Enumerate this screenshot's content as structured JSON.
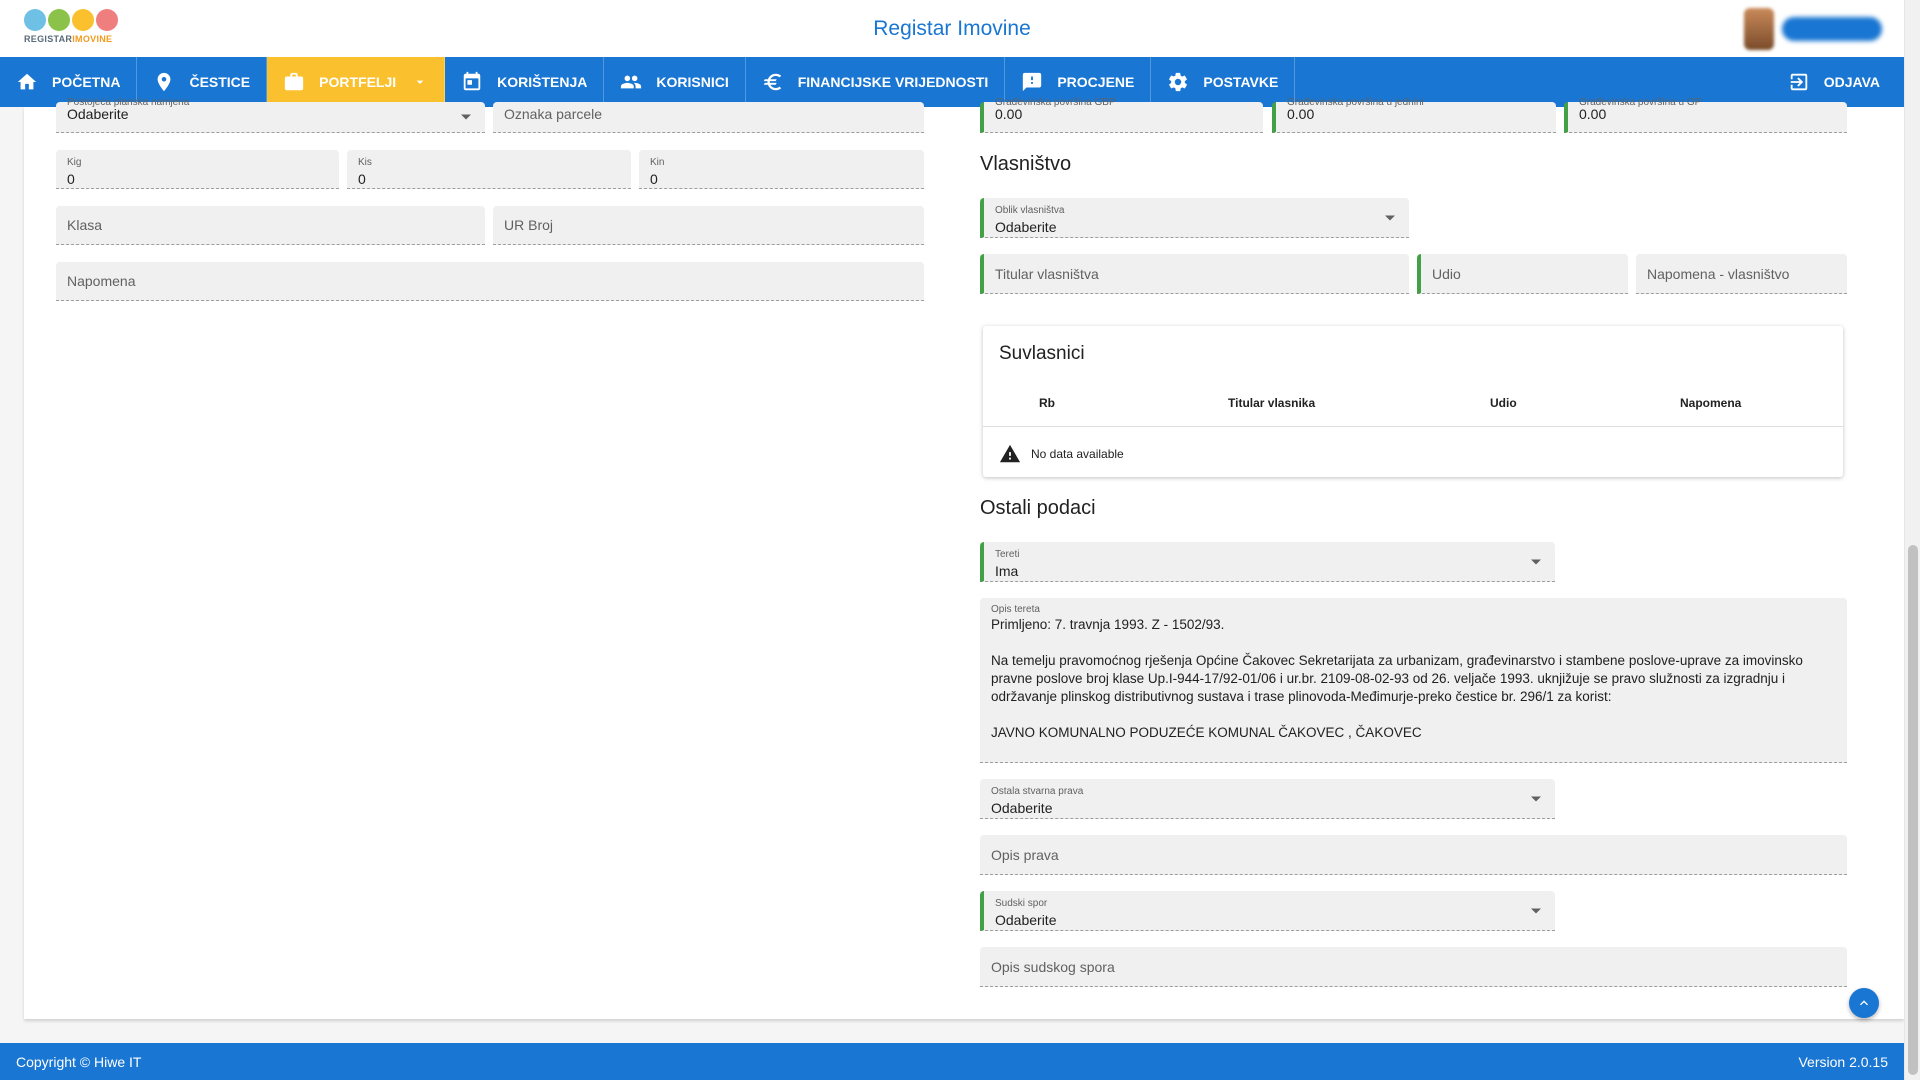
{
  "header": {
    "logo_text_a": "REGISTAR",
    "logo_text_b": "IMOVINE",
    "app_title": "Registar Imovine"
  },
  "nav": {
    "items": [
      {
        "label": "POČETNA",
        "icon": "home-icon"
      },
      {
        "label": "ČESTICE",
        "icon": "map-pin-icon"
      },
      {
        "label": "PORTFELJI",
        "icon": "briefcase-icon"
      },
      {
        "label": "KORIŠTENJA",
        "icon": "calendar-icon"
      },
      {
        "label": "KORISNICI",
        "icon": "people-icon"
      },
      {
        "label": "FINANCIJSKE VRIJEDNOSTI",
        "icon": "euro-icon"
      },
      {
        "label": "PROCJENE",
        "icon": "feedback-icon"
      },
      {
        "label": "POSTAVKE",
        "icon": "gear-icon"
      }
    ],
    "logout_label": "ODJAVA",
    "active_color": "#fbc02d",
    "bar_color": "#1976d2"
  },
  "left": {
    "namjena": {
      "label": "Postojeća planska namjena",
      "value": "Odaberite"
    },
    "oznaka_parcele": {
      "placeholder": "Oznaka parcele"
    },
    "kig": {
      "label": "Kig",
      "value": "0"
    },
    "kis": {
      "label": "Kis",
      "value": "0"
    },
    "kin": {
      "label": "Kin",
      "value": "0"
    },
    "klasa": {
      "placeholder": "Klasa"
    },
    "ur_broj": {
      "placeholder": "UR Broj"
    },
    "napomena": {
      "placeholder": "Napomena"
    }
  },
  "right": {
    "povrsine": [
      {
        "label": "Građevinska površina GBP",
        "value": "0.00"
      },
      {
        "label": "Građevinska površina u jednini",
        "value": "0.00"
      },
      {
        "label": "Građevinska površina u GP",
        "value": "0.00"
      }
    ],
    "vlasnistvo": {
      "title": "Vlasništvo",
      "oblik": {
        "label": "Oblik vlasništva",
        "value": "Odaberite"
      },
      "titular": {
        "placeholder": "Titular vlasništva"
      },
      "udio": {
        "placeholder": "Udio"
      },
      "napomena": {
        "placeholder": "Napomena - vlasništvo"
      }
    },
    "suvlasnici": {
      "title": "Suvlasnici",
      "columns": [
        "Rb",
        "Titular vlasnika",
        "Udio",
        "Napomena"
      ],
      "empty_text": "No data available"
    },
    "ostali": {
      "title": "Ostali podaci",
      "tereti": {
        "label": "Tereti",
        "value": "Ima"
      },
      "opis_tereta": {
        "label": "Opis tereta",
        "value": "Primljeno: 7. travnja 1993. Z - 1502/93.\n\nNa temelju pravomoćnog rješenja Općine Čakovec Sekretarijata za urbanizam, građevinarstvo i stambene poslove-uprave za imovinsko pravne poslove broj klase Up.I-944-17/92-01/06 i ur.br. 2109-08-02-93 od 26. veljače 1993. uknjižuje se pravo služnosti za izgradnju i održavanje plinskog distributivnog sustava i trase plinovoda-Međimurje-preko čestice br. 296/1 za korist:\n\nJAVNO KOMUNALNO PODUZEĆE KOMUNAL ČAKOVEC , ČAKOVEC"
      },
      "stvarna_prava": {
        "label": "Ostala stvarna prava",
        "value": "Odaberite"
      },
      "opis_prava": {
        "placeholder": "Opis prava"
      },
      "sudski_spor": {
        "label": "Sudski spor",
        "value": "Odaberite"
      },
      "opis_spora": {
        "placeholder": "Opis sudskog spora"
      }
    }
  },
  "footer": {
    "copyright": "Copyright © Hiwe IT",
    "version": "Version 2.0.15"
  }
}
